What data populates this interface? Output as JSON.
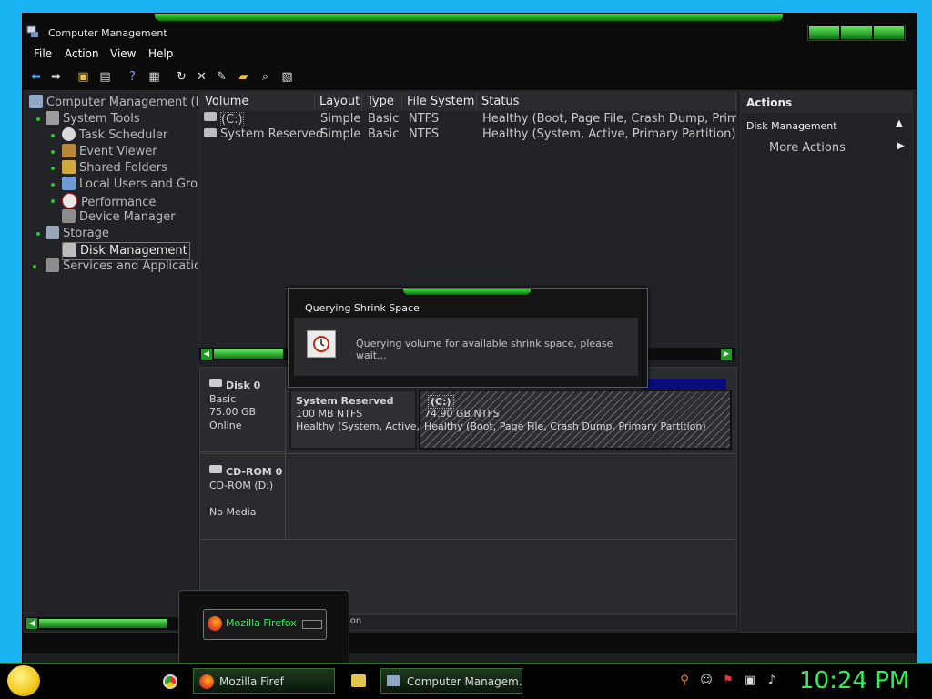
{
  "window": {
    "title": "Computer Management",
    "menu": [
      "File",
      "Action",
      "View",
      "Help"
    ]
  },
  "tree": {
    "items": [
      {
        "label": "Computer Management (Loc",
        "icon": "computer-icon",
        "level": 0
      },
      {
        "label": "System Tools",
        "icon": "tools-icon",
        "level": 1
      },
      {
        "label": "Task Scheduler",
        "icon": "clock-icon",
        "level": 2
      },
      {
        "label": "Event Viewer",
        "icon": "event-viewer-icon",
        "level": 2
      },
      {
        "label": "Shared Folders",
        "icon": "shared-folders-icon",
        "level": 2
      },
      {
        "label": "Local Users and Grou",
        "icon": "users-icon",
        "level": 2
      },
      {
        "label": "Performance",
        "icon": "performance-icon",
        "level": 2
      },
      {
        "label": "Device Manager",
        "icon": "device-manager-icon",
        "level": 2
      },
      {
        "label": "Storage",
        "icon": "storage-icon",
        "level": 1
      },
      {
        "label": "Disk Management",
        "icon": "disk-icon",
        "level": 2
      },
      {
        "label": "Services and Applications",
        "icon": "services-icon",
        "level": 1
      }
    ]
  },
  "volumes": {
    "columns": [
      "Volume",
      "Layout",
      "Type",
      "File System",
      "Status"
    ],
    "rows": [
      [
        "(C:)",
        "Simple",
        "Basic",
        "NTFS",
        "Healthy (Boot, Page File, Crash Dump, Primary"
      ],
      [
        "System Reserved",
        "Simple",
        "Basic",
        "NTFS",
        "Healthy (System, Active, Primary Partition)"
      ]
    ]
  },
  "disks": {
    "disk0": {
      "name": "Disk 0",
      "type": "Basic",
      "size": "75.00 GB",
      "state": "Online"
    },
    "sysres": {
      "name": "System Reserved",
      "size": "100 MB NTFS",
      "status": "Healthy (System, Active, P"
    },
    "c": {
      "name": "(C:)",
      "size": "74.90 GB NTFS",
      "status": "Healthy (Boot, Page File, Crash Dump, Primary Partition)"
    },
    "cdrom": {
      "name": "CD-ROM 0",
      "drive": "CD-ROM (D:)",
      "state": "No Media"
    },
    "statusbar_fragment": "ion"
  },
  "actions": {
    "header": "Actions",
    "section": "Disk Management",
    "more": "More Actions"
  },
  "dialog": {
    "title": "Querying Shrink Space",
    "message": "Querying volume for available shrink space, please wait..."
  },
  "preview": {
    "label": "Mozilla Firefox"
  },
  "taskbar": {
    "firefox": "Mozilla Firef",
    "compmgmt": "Computer Managem...",
    "clock": "10:24 PM"
  },
  "colors": {
    "accent": "#2ef05a",
    "desktop": "#18b3f0"
  }
}
